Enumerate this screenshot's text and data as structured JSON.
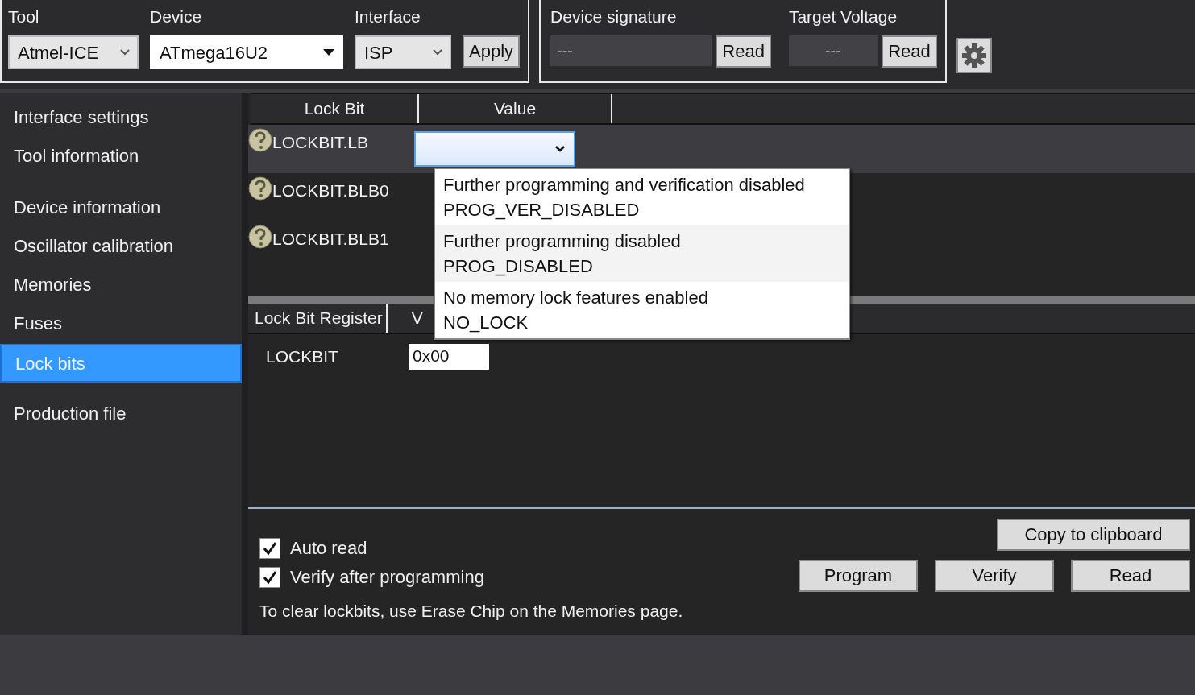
{
  "toolbar": {
    "tool": {
      "label": "Tool",
      "value": "Atmel-ICE"
    },
    "device": {
      "label": "Device",
      "value": "ATmega16U2"
    },
    "interface": {
      "label": "Interface",
      "value": "ISP"
    },
    "apply": "Apply",
    "signature": {
      "label": "Device signature",
      "value": "---",
      "button": "Read"
    },
    "voltage": {
      "label": "Target Voltage",
      "value": "---",
      "button": "Read"
    }
  },
  "sidebar": {
    "groups": [
      {
        "items": [
          {
            "label": "Interface settings",
            "selected": false
          },
          {
            "label": "Tool information",
            "selected": false
          }
        ]
      },
      {
        "items": [
          {
            "label": "Device information",
            "selected": false
          },
          {
            "label": "Oscillator calibration",
            "selected": false
          },
          {
            "label": "Memories",
            "selected": false
          },
          {
            "label": "Fuses",
            "selected": false
          },
          {
            "label": "Lock bits",
            "selected": true
          }
        ]
      },
      {
        "items": [
          {
            "label": "Production file",
            "selected": false
          }
        ]
      }
    ]
  },
  "lockbit_table": {
    "columns": [
      "Lock Bit",
      "Value"
    ],
    "rows": [
      {
        "name": "LOCKBIT.LB",
        "selected": true
      },
      {
        "name": "LOCKBIT.BLB0",
        "selected": false
      },
      {
        "name": "LOCKBIT.BLB1",
        "selected": false
      }
    ]
  },
  "dropdown_options": [
    {
      "description": "Further programming and verification disabled",
      "name": "PROG_VER_DISABLED",
      "highlighted": false
    },
    {
      "description": "Further programming disabled",
      "name": "PROG_DISABLED",
      "highlighted": true
    },
    {
      "description": "No memory lock features enabled",
      "name": "NO_LOCK",
      "highlighted": false
    }
  ],
  "register_table": {
    "columns": [
      "Lock Bit Register",
      "V"
    ],
    "rows": [
      {
        "name": "LOCKBIT",
        "value": "0x00"
      }
    ]
  },
  "options": [
    {
      "label": "Auto read",
      "checked": true
    },
    {
      "label": "Verify after programming",
      "checked": true
    }
  ],
  "copy_button": "Copy to clipboard",
  "action_buttons": [
    "Program",
    "Verify",
    "Read"
  ],
  "note": "To clear lockbits, use Erase Chip on the Memories page."
}
